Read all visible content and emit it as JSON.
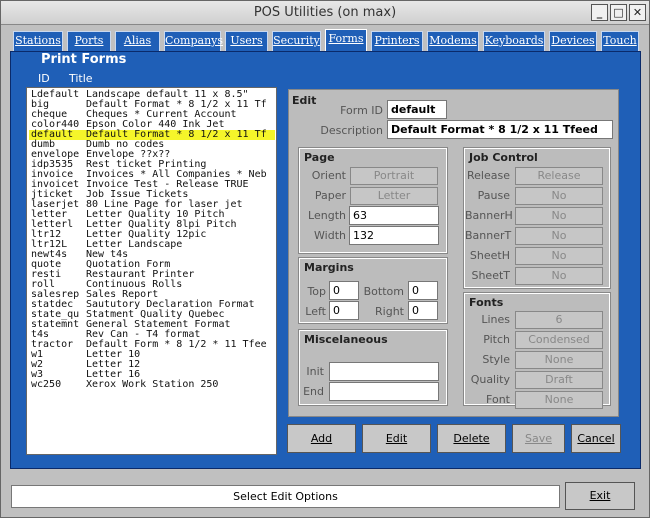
{
  "window": {
    "title": "POS Utilities (on max)"
  },
  "tabs": [
    "Stations",
    "Ports",
    "Alias",
    "Companys",
    "Users",
    "Security",
    "Forms",
    "Printers",
    "Modems",
    "Keyboards",
    "Devices",
    "Touch"
  ],
  "active_tab": "Forms",
  "panel": {
    "title": "Print Forms",
    "col_id": "ID",
    "col_title": "Title"
  },
  "forms": [
    {
      "id": "Ldefault",
      "title": "Landscape default 11 x 8.5\""
    },
    {
      "id": "big",
      "title": "Default Format * 8 1/2 x 11 Tf"
    },
    {
      "id": "cheque",
      "title": "Cheques * Current Account"
    },
    {
      "id": "color440",
      "title": "Epson Color 440 Ink Jet"
    },
    {
      "id": "default",
      "title": "Default Format * 8 1/2 x 11 Tf"
    },
    {
      "id": "dumb",
      "title": "Dumb no codes"
    },
    {
      "id": "envelope",
      "title": "Envelope ??x??"
    },
    {
      "id": "idp3535",
      "title": "Rest ticket Printing"
    },
    {
      "id": "invoice",
      "title": "Invoices * All Companies * Neb"
    },
    {
      "id": "invoicet",
      "title": "Invoice Test - Release TRUE"
    },
    {
      "id": "jticket",
      "title": "Job Issue Tickets"
    },
    {
      "id": "laserjet",
      "title": "80 Line Page for laser jet"
    },
    {
      "id": "letter",
      "title": "Letter Quality 10 Pitch"
    },
    {
      "id": "letterl",
      "title": "Letter Quality 8lpi Pitch"
    },
    {
      "id": "ltr12",
      "title": "Letter Quality 12pic"
    },
    {
      "id": "ltr12L",
      "title": "Letter Landscape"
    },
    {
      "id": "newt4s",
      "title": "New t4s"
    },
    {
      "id": "quote",
      "title": "Quotation Form"
    },
    {
      "id": "resti",
      "title": "Restaurant Printer"
    },
    {
      "id": "roll",
      "title": "Continuous Rolls"
    },
    {
      "id": "salesrep",
      "title": "Sales Report"
    },
    {
      "id": "statdec",
      "title": "Saututory Declaration Format"
    },
    {
      "id": "state_qu",
      "title": "Statment Quality Quebec"
    },
    {
      "id": "statemnt",
      "title": "General Statement Format"
    },
    {
      "id": "t4s",
      "title": "Rev Can - T4 format"
    },
    {
      "id": "tractor",
      "title": "Default Form * 8 1/2 * 11 Tfee"
    },
    {
      "id": "w1",
      "title": "Letter 10"
    },
    {
      "id": "w2",
      "title": "Letter 12"
    },
    {
      "id": "w3",
      "title": "Letter 16"
    },
    {
      "id": "wc250",
      "title": "Xerox Work Station 250"
    }
  ],
  "selected_form": "default",
  "edit": {
    "title": "Edit",
    "form_id_label": "Form ID",
    "form_id": "default",
    "description_label": "Description",
    "description": "Default Format * 8 1/2 x 11 Tfeed"
  },
  "page": {
    "title": "Page",
    "orient_label": "Orient",
    "orient": "Portrait",
    "paper_label": "Paper",
    "paper": "Letter",
    "length_label": "Length",
    "length": "63",
    "width_label": "Width",
    "width": "132"
  },
  "margins": {
    "title": "Margins",
    "top_label": "Top",
    "top": "0",
    "bottom_label": "Bottom",
    "bottom": "0",
    "left_label": "Left",
    "left": "0",
    "right_label": "Right",
    "right": "0"
  },
  "misc": {
    "title": "Miscelaneous",
    "init_label": "Init",
    "init": "",
    "end_label": "End",
    "end": ""
  },
  "job_control": {
    "title": "Job Control",
    "release_label": "Release",
    "release": "Release",
    "pause_label": "Pause",
    "pause": "No",
    "bannerh_label": "BannerH",
    "bannerh": "No",
    "bannert_label": "BannerT",
    "bannert": "No",
    "sheeth_label": "SheetH",
    "sheeth": "No",
    "sheett_label": "SheetT",
    "sheett": "No"
  },
  "fonts": {
    "title": "Fonts",
    "lines_label": "Lines",
    "lines": "6",
    "pitch_label": "Pitch",
    "pitch": "Condensed",
    "style_label": "Style",
    "style": "None",
    "quality_label": "Quality",
    "quality": "Draft",
    "font_label": "Font",
    "font": "None"
  },
  "buttons": {
    "add": "Add",
    "edit": "Edit",
    "delete": "Delete",
    "save": "Save",
    "cancel": "Cancel",
    "exit": "Exit"
  },
  "status": "Select Edit Options"
}
